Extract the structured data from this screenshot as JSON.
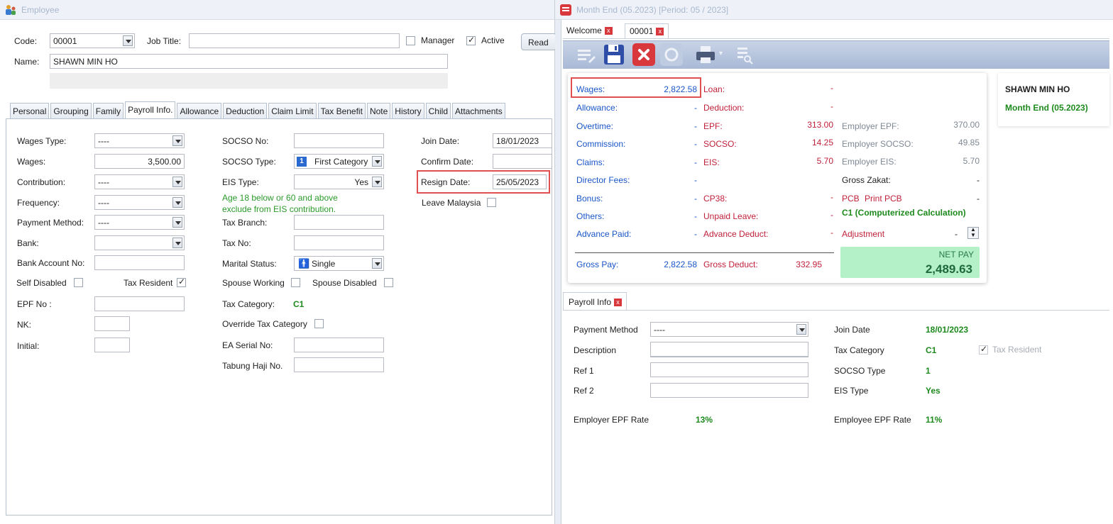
{
  "employee_window": {
    "title": "Employee",
    "code_label": "Code:",
    "code_value": "00001",
    "job_title_label": "Job Title:",
    "job_title_value": "",
    "manager_label": "Manager",
    "manager_checked": false,
    "active_label": "Active",
    "active_checked": true,
    "read_button": "Read",
    "name_label": "Name:",
    "name_value": "SHAWN MIN HO",
    "tabs": [
      "Personal",
      "Grouping",
      "Family",
      "Payroll Info.",
      "Allowance",
      "Deduction",
      "Claim Limit",
      "Tax Benefit",
      "Note",
      "History",
      "Child",
      "Attachments"
    ],
    "active_tab": "Payroll Info.",
    "col1": {
      "wages_type_label": "Wages Type:",
      "wages_type_value": "----",
      "wages_label": "Wages:",
      "wages_value": "3,500.00",
      "contribution_label": "Contribution:",
      "contribution_value": "----",
      "frequency_label": "Frequency:",
      "frequency_value": "----",
      "payment_method_label": "Payment Method:",
      "payment_method_value": "----",
      "bank_label": "Bank:",
      "bank_value": "",
      "bank_account_label": "Bank Account No:",
      "bank_account_value": "",
      "self_disabled_label": "Self Disabled",
      "self_disabled_checked": false,
      "tax_resident_label": "Tax Resident",
      "tax_resident_checked": true,
      "epf_no_label": "EPF No :",
      "epf_no_value": "",
      "nk_label": "NK:",
      "nk_value": "",
      "initial_label": "Initial:",
      "initial_value": ""
    },
    "col2": {
      "socso_no_label": "SOCSO No:",
      "socso_no_value": "",
      "socso_type_label": "SOCSO Type:",
      "socso_type_badge": "1",
      "socso_type_value": "First Category",
      "eis_type_label": "EIS Type:",
      "eis_type_value": "Yes",
      "eis_note_1": "Age 18 below or 60 and above",
      "eis_note_2": "exclude from EIS contribution.",
      "tax_branch_label": "Tax Branch:",
      "tax_branch_value": "",
      "tax_no_label": "Tax No:",
      "tax_no_value": "",
      "marital_label": "Marital Status:",
      "marital_value": "Single",
      "spouse_working_label": "Spouse Working",
      "spouse_working_checked": false,
      "spouse_disabled_label": "Spouse Disabled",
      "spouse_disabled_checked": false,
      "tax_category_label": "Tax Category:",
      "tax_category_value": "C1",
      "override_label": "Override Tax Category",
      "override_checked": false,
      "ea_serial_label": "EA Serial No:",
      "ea_serial_value": "",
      "tabung_label": "Tabung Haji No.",
      "tabung_value": ""
    },
    "col3": {
      "join_date_label": "Join Date:",
      "join_date_value": "18/01/2023",
      "confirm_date_label": "Confirm Date:",
      "confirm_date_value": "",
      "resign_date_label": "Resign Date:",
      "resign_date_value": "25/05/2023",
      "leave_malaysia_label": "Leave Malaysia",
      "leave_malaysia_checked": false
    }
  },
  "month_end_window": {
    "title": "Month End (05.2023) [Period: 05 / 2023]",
    "tabs": [
      {
        "label": "Welcome",
        "closable": true
      },
      {
        "label": "00001",
        "closable": true
      }
    ],
    "toolbar_icons": [
      "edit-icon",
      "save-icon",
      "cancel-icon",
      "refresh-icon",
      "print-icon",
      "preview-icon"
    ],
    "earnings": [
      {
        "label": "Wages:",
        "value": "2,822.58"
      },
      {
        "label": "Allowance:",
        "value": "-"
      },
      {
        "label": "Overtime:",
        "value": "-"
      },
      {
        "label": "Commission:",
        "value": "-"
      },
      {
        "label": "Claims:",
        "value": "-"
      },
      {
        "label": "Director Fees:",
        "value": "-"
      },
      {
        "label": "Bonus:",
        "value": "-"
      },
      {
        "label": "Others:",
        "value": "-"
      },
      {
        "label": "Advance Paid:",
        "value": "-"
      }
    ],
    "deductions": [
      {
        "label": "Loan:",
        "value": "-"
      },
      {
        "label": "Deduction:",
        "value": "-"
      },
      {
        "label": "EPF:",
        "value": "313.00"
      },
      {
        "label": "SOCSO:",
        "value": "14.25"
      },
      {
        "label": "EIS:",
        "value": "5.70"
      },
      {
        "label": "",
        "value": ""
      },
      {
        "label": "CP38:",
        "value": "-"
      },
      {
        "label": "Unpaid Leave:",
        "value": "-"
      },
      {
        "label": "Advance Deduct:",
        "value": "-"
      }
    ],
    "employer": [
      {
        "label": "Employer EPF:",
        "value": "370.00"
      },
      {
        "label": "Employer SOCSO:",
        "value": "49.85"
      },
      {
        "label": "Employer EIS:",
        "value": "5.70"
      },
      {
        "label": "Gross Zakat:",
        "value": "-"
      }
    ],
    "pcb_label": "PCB",
    "print_pcb_label": "Print PCB",
    "pcb_value": "-",
    "pcb_method": "C1 (Computerized Calculation)",
    "adjustment_label": "Adjustment",
    "adjustment_value": "-",
    "gross_pay_label": "Gross Pay:",
    "gross_pay_value": "2,822.58",
    "gross_deduct_label": "Gross Deduct:",
    "gross_deduct_value": "332.95",
    "net_pay_label": "NET PAY",
    "net_pay_value": "2,489.63",
    "employee_name": "SHAWN MIN HO",
    "period_name": "Month End (05.2023)",
    "payroll_info": {
      "tab_label": "Payroll Info",
      "payment_method_label": "Payment Method",
      "payment_method_value": "----",
      "description_label": "Description",
      "description_value": "",
      "ref1_label": "Ref 1",
      "ref1_value": "",
      "ref2_label": "Ref 2",
      "ref2_value": "",
      "join_date_label": "Join Date",
      "join_date_value": "18/01/2023",
      "tax_category_label": "Tax Category",
      "tax_category_value": "C1",
      "tax_resident_label": "Tax Resident",
      "tax_resident_checked": true,
      "socso_type_label": "SOCSO Type",
      "socso_type_value": "1",
      "eis_type_label": "EIS Type",
      "eis_type_value": "Yes",
      "employer_epf_rate_label": "Employer EPF Rate",
      "employer_epf_rate_value": "13%",
      "employee_epf_rate_label": "Employee EPF Rate",
      "employee_epf_rate_value": "11%"
    }
  }
}
